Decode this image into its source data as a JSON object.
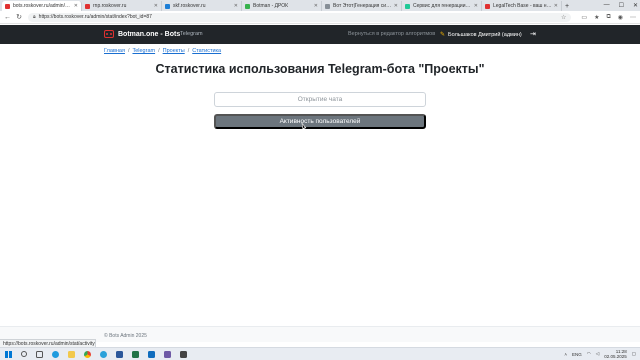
{
  "browser": {
    "tabs": [
      {
        "title": "bots.roskover.ru/admin/stat/index",
        "favicon_color": "#e03131",
        "active": true
      },
      {
        "title": "rnp.roskover.ru",
        "favicon_color": "#e03131",
        "active": false
      },
      {
        "title": "skf.roskover.ru",
        "favicon_color": "#1c7ed6",
        "active": false
      },
      {
        "title": "Botman - ДРОК",
        "favicon_color": "#37b24d",
        "active": false
      },
      {
        "title": "Вот Этот|Генерация сигнатур",
        "favicon_color": "#868e96",
        "active": false
      },
      {
        "title": "Сервис для генерации документов",
        "favicon_color": "#20c997",
        "active": false
      },
      {
        "title": "LegalTech Base - ваш навигатор",
        "favicon_color": "#e03131",
        "active": false
      }
    ],
    "new_tab_symbol": "+",
    "url": "https://bots.roskover.ru/admin/stat/index?bot_id=87",
    "status_link": "https://bots.roskover.ru/admin/stat/activity?bot_id=87"
  },
  "navbar": {
    "brand": "Botman.one - Bots",
    "telegram_link": "Telegram",
    "back_link": "Вернуться в редактор алгоритмов",
    "user": "Большаков Дмитрий (админ)",
    "accent_color": "#e03131"
  },
  "breadcrumb": {
    "items": [
      "Главная",
      "Telegram",
      "Проекты",
      "Статистика"
    ]
  },
  "main": {
    "title": "Статистика использования Telegram-бота \"Проекты\"",
    "chat_open_label": "Открытие чата",
    "activity_button": "Активность пользователей"
  },
  "footer": {
    "text": "© Bots Admin 2025"
  },
  "taskbar": {
    "lang": "ENG",
    "time": "11:28",
    "date": "02.05.2025"
  }
}
